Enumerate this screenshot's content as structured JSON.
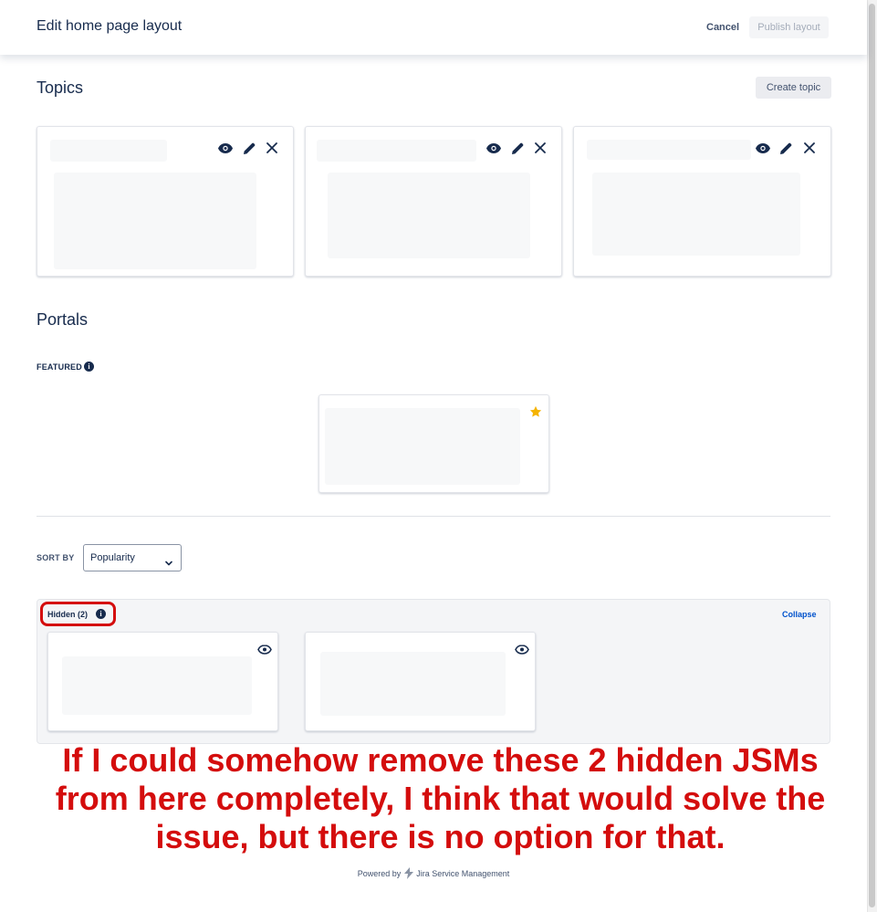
{
  "header": {
    "title": "Edit home page layout",
    "cancel_label": "Cancel",
    "publish_label": "Publish layout"
  },
  "topics": {
    "heading": "Topics",
    "create_label": "Create topic",
    "cards": [
      {
        "actions": [
          "eye-icon",
          "pencil-icon",
          "close-icon"
        ]
      },
      {
        "actions": [
          "eye-icon",
          "pencil-icon",
          "close-icon"
        ]
      },
      {
        "actions": [
          "eye-icon",
          "pencil-icon",
          "close-icon"
        ]
      }
    ]
  },
  "portals": {
    "heading": "Portals",
    "featured_label": "FEATURED",
    "featured_icon": "star-icon",
    "sort_label": "SORT BY",
    "sort_value": "Popularity",
    "hidden_label": "Hidden (2)",
    "collapse_label": "Collapse"
  },
  "annotation": {
    "text": "If I could somehow remove these 2 hidden JSMs from here completely, I think that would solve the issue, but there is no option for that."
  },
  "footer": {
    "powered_by": "Powered by",
    "product": "Jira Service Management"
  },
  "colors": {
    "annotation_red": "#d40d0d",
    "link_blue": "#0052cc",
    "star_yellow": "#f5b301"
  }
}
